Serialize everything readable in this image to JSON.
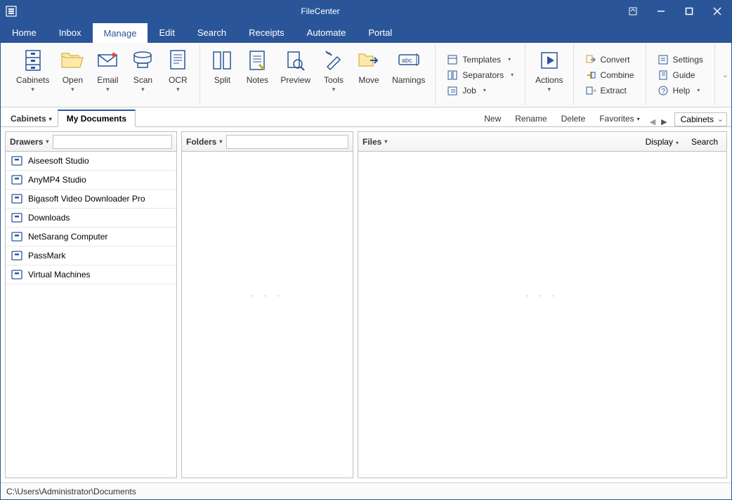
{
  "title": "FileCenter",
  "menu": [
    "Home",
    "Inbox",
    "Manage",
    "Edit",
    "Search",
    "Receipts",
    "Automate",
    "Portal"
  ],
  "menu_active": 2,
  "ribbon": {
    "cabinets": "Cabinets",
    "open": "Open",
    "email": "Email",
    "scan": "Scan",
    "ocr": "OCR",
    "split": "Split",
    "notes": "Notes",
    "preview": "Preview",
    "tools": "Tools",
    "move": "Move",
    "namings": "Namings",
    "templates": "Templates",
    "separators": "Separators",
    "job": "Job",
    "actions": "Actions",
    "convert": "Convert",
    "combine": "Combine",
    "extract": "Extract",
    "settings": "Settings",
    "guide": "Guide",
    "help": "Help"
  },
  "tabs": {
    "control": "Cabinets",
    "active": "My Documents"
  },
  "toolbar": {
    "new": "New",
    "rename": "Rename",
    "delete": "Delete",
    "favorites": "Favorites",
    "cab_select": "Cabinets"
  },
  "panels": {
    "drawers": "Drawers",
    "folders": "Folders",
    "files": "Files",
    "display": "Display",
    "search": "Search"
  },
  "drawers": [
    "Aiseesoft Studio",
    "AnyMP4 Studio",
    "Bigasoft Video Downloader Pro",
    "Downloads",
    "NetSarang Computer",
    "PassMark",
    "Virtual Machines"
  ],
  "status": "C:\\Users\\Administrator\\Documents"
}
